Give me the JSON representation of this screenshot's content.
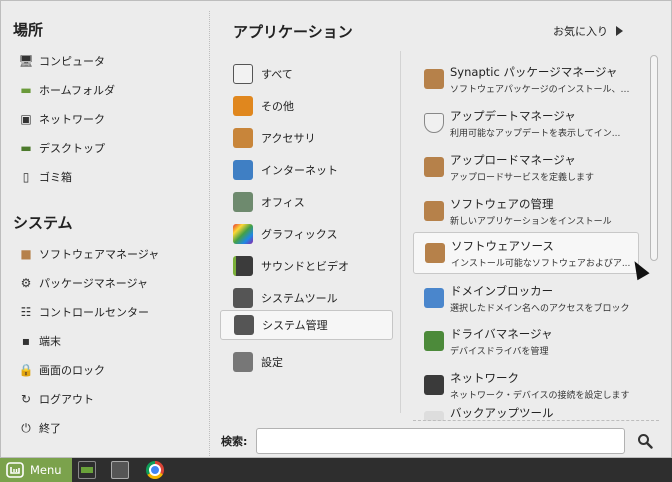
{
  "left": {
    "places_title": "場所",
    "places": [
      {
        "label": "コンピュータ",
        "icon": "computer-icon"
      },
      {
        "label": "ホームフォルダ",
        "icon": "home-folder-icon"
      },
      {
        "label": "ネットワーク",
        "icon": "network-icon"
      },
      {
        "label": "デスクトップ",
        "icon": "desktop-icon"
      },
      {
        "label": "ゴミ箱",
        "icon": "trash-icon"
      }
    ],
    "system_title": "システム",
    "system": [
      {
        "label": "ソフトウェアマネージャ",
        "icon": "software-manager-icon"
      },
      {
        "label": "パッケージマネージャ",
        "icon": "package-manager-icon"
      },
      {
        "label": "コントロールセンター",
        "icon": "control-center-icon"
      },
      {
        "label": "端末",
        "icon": "terminal-icon"
      },
      {
        "label": "画面のロック",
        "icon": "lock-icon"
      },
      {
        "label": "ログアウト",
        "icon": "logout-icon"
      },
      {
        "label": "終了",
        "icon": "power-icon"
      }
    ]
  },
  "apps": {
    "title": "アプリケーション",
    "favorites_label": "お気に入り",
    "categories": [
      {
        "label": "すべて",
        "color": "#f2f2f2"
      },
      {
        "label": "その他",
        "color": "#e0871e"
      },
      {
        "label": "アクセサリ",
        "color": "#c8853a"
      },
      {
        "label": "インターネット",
        "color": "#3f7fc4"
      },
      {
        "label": "オフィス",
        "color": "#6e8a6e"
      },
      {
        "label": "グラフィックス",
        "color": "#c44fc0"
      },
      {
        "label": "サウンドとビデオ",
        "color": "#3b3b3b"
      },
      {
        "label": "システムツール",
        "color": "#555555"
      },
      {
        "label": "システム管理",
        "color": "#555555"
      },
      {
        "label": "設定",
        "color": "#777777"
      }
    ],
    "selected_category_index": 8,
    "items": [
      {
        "title": "Synaptic パッケージマネージャ",
        "desc": "ソフトウェアパッケージのインストール、削...",
        "color": "#b6814a"
      },
      {
        "title": "アップデートマネージャ",
        "desc": "利用可能なアップデートを表示してイン...",
        "color": "#f0f0f0"
      },
      {
        "title": "アップロードマネージャ",
        "desc": "アップロードサービスを定義します",
        "color": "#b6814a"
      },
      {
        "title": "ソフトウェアの管理",
        "desc": "新しいアプリケーションをインストール",
        "color": "#b6814a"
      },
      {
        "title": "ソフトウェアソース",
        "desc": "インストール可能なソフトウェアおよびア...",
        "color": "#b6814a"
      },
      {
        "title": "ドメインブロッカー",
        "desc": "選択したドメイン名へのアクセスをブロック",
        "color": "#4a86cc"
      },
      {
        "title": "ドライバマネージャ",
        "desc": "デバイスドライバを管理",
        "color": "#4c8a3a"
      },
      {
        "title": "ネットワーク",
        "desc": "ネットワーク・デバイスの接続を設定します",
        "color": "#3a3a3a"
      },
      {
        "title": "バックアップツール",
        "desc": "",
        "color": "#dddddd"
      }
    ],
    "highlighted_item_index": 4
  },
  "search": {
    "label": "検索:",
    "value": ""
  },
  "panel": {
    "menu_label": "Menu"
  }
}
